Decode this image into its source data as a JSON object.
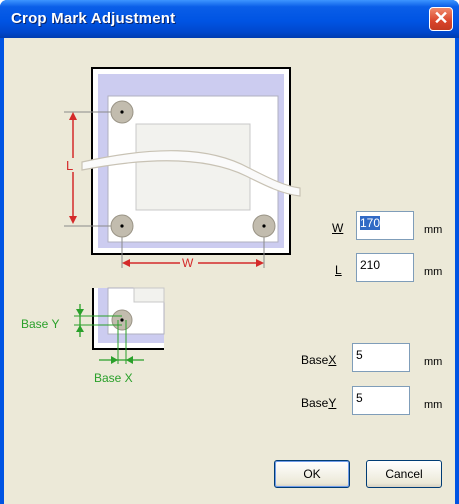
{
  "window": {
    "title": "Crop Mark Adjustment",
    "close_symbol": "✕"
  },
  "diagram": {
    "label_l": "L",
    "label_w": "W",
    "label_base_y": "Base Y",
    "label_base_x": "Base X",
    "dimension_color": "#d42a2a",
    "base_color": "#2aa02a"
  },
  "fields": {
    "w": {
      "label_prefix": "",
      "label_mnemonic": "W",
      "label_suffix": "",
      "value": "170",
      "unit": "mm"
    },
    "l": {
      "label_prefix": "",
      "label_mnemonic": "L",
      "label_suffix": "",
      "value": "210",
      "unit": "mm"
    },
    "base_x": {
      "label_prefix": "Base",
      "label_mnemonic": "X",
      "label_suffix": "",
      "value": "5",
      "unit": "mm"
    },
    "base_y": {
      "label_prefix": "Base",
      "label_mnemonic": "Y",
      "label_suffix": "",
      "value": "5",
      "unit": "mm"
    }
  },
  "buttons": {
    "ok": "OK",
    "cancel": "Cancel"
  }
}
